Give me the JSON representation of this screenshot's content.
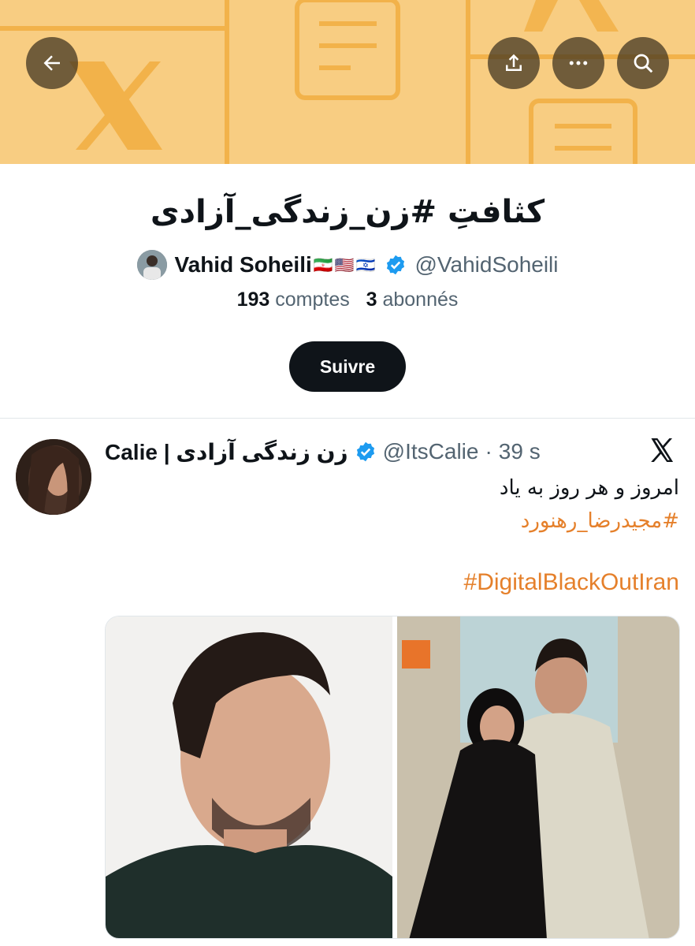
{
  "banner": {
    "back_icon": "arrow-left-icon",
    "share_icon": "share-upload-icon",
    "more_icon": "more-horizontal-icon",
    "search_icon": "search-icon",
    "colors": {
      "background": "#f8cd82",
      "pattern": "#f2b24a"
    }
  },
  "list": {
    "title": "کثافتِ #زن_زندگی_آزادی",
    "owner_name": "Vahid Soheili",
    "owner_flags": "🇮🇷🇺🇸🇮🇱",
    "owner_handle": "@VahidSoheili",
    "members_count": "193",
    "members_label": "comptes",
    "followers_count": "3",
    "followers_label": "abonnés",
    "follow_label": "Suivre"
  },
  "tweet": {
    "author_name": "Calie | زن زندگی آزادی",
    "author_handle": "@ItsCalie",
    "separator": "·",
    "time": "39 s",
    "text_line": "امروز و هر روز به یاد",
    "hashtag_fa": "#مجیدرضا_رهنورد",
    "hashtag_en": "#DigitalBlackOutIran",
    "source_icon": "x-logo-icon"
  },
  "colors": {
    "accent_link": "#e5802b",
    "verified": "#1d9bf0",
    "text_primary": "#0f1419",
    "text_secondary": "#536471"
  }
}
